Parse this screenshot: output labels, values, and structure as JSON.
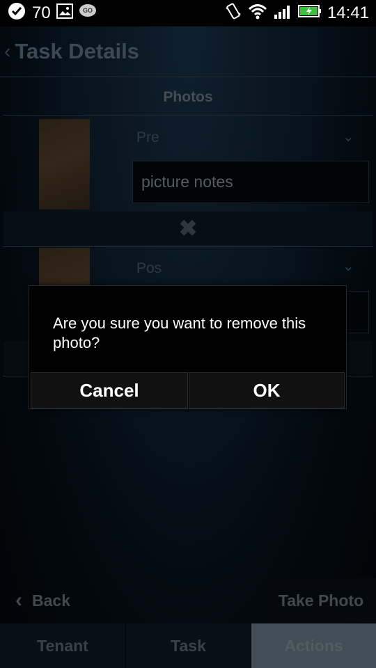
{
  "status": {
    "battery_percent": "70",
    "time": "14:41"
  },
  "header": {
    "title": "Task Details"
  },
  "photos_section": {
    "label": "Photos",
    "items": [
      {
        "type": "Pre",
        "notes": "picture notes"
      },
      {
        "type": "Pos",
        "notes": ""
      }
    ]
  },
  "bottom": {
    "back_label": "Back",
    "take_photo_label": "Take Photo"
  },
  "tabs": [
    {
      "label": "Tenant",
      "active": false
    },
    {
      "label": "Task",
      "active": false
    },
    {
      "label": "Actions",
      "active": true
    }
  ],
  "dialog": {
    "message": "Are you sure you want to remove this photo?",
    "cancel_label": "Cancel",
    "ok_label": "OK"
  },
  "colors": {
    "title": "#6d8596",
    "tab_active_bg": "#7b8c9c",
    "tab_bg": "#0d1c2b",
    "dialog_bg": "#000000"
  }
}
